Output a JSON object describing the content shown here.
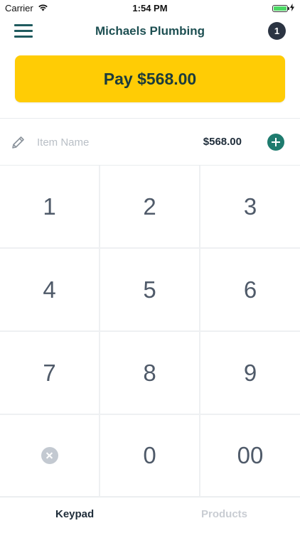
{
  "status_bar": {
    "carrier": "Carrier",
    "time": "1:54 PM"
  },
  "header": {
    "title": "Michaels Plumbing",
    "cart_count": "1"
  },
  "pay_button": {
    "label": "Pay $568.00"
  },
  "item": {
    "placeholder": "Item Name",
    "amount": "$568.00"
  },
  "keypad": {
    "keys": [
      "1",
      "2",
      "3",
      "4",
      "5",
      "6",
      "7",
      "8",
      "9",
      "",
      "0",
      "00"
    ]
  },
  "tabs": {
    "keypad": "Keypad",
    "products": "Products",
    "active": "Keypad"
  },
  "colors": {
    "accent_yellow": "#ffcc05",
    "brand_teal": "#1d4f52",
    "add_button_green": "#1e7b6e",
    "badge_dark": "#2b3442"
  }
}
